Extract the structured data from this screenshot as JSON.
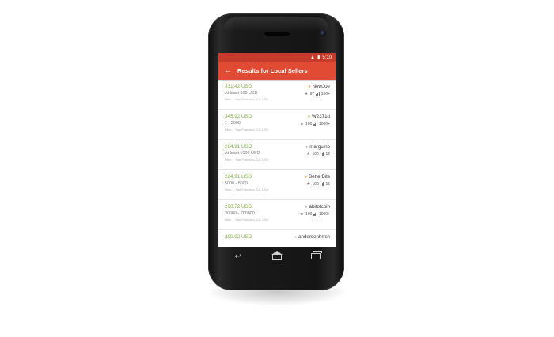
{
  "status_bar": {
    "time": "5:10",
    "signal_icon": "signal-icon",
    "battery_icon": "battery-icon"
  },
  "app_bar": {
    "title": "Results for Local Sellers",
    "back_icon": "arrow-back-icon"
  },
  "results": [
    {
      "price": "331.42 USD",
      "amount": "At least 500 USD",
      "location": "Elkin ... San Francisco, CA, USA",
      "seller": "NewJoe",
      "online_color": "#f1a33a",
      "rating": "97",
      "trades": "100+"
    },
    {
      "price": "345.92 USD",
      "amount": "1 - 2000",
      "location": "Elkin ... San Francisco, CA, USA",
      "seller": "W2371d",
      "online_color": "#7fae3f",
      "rating": "100",
      "trades": "1000+"
    },
    {
      "price": "284.91 USD",
      "amount": "At least 5000 USD",
      "location": "Elkin ... San Francisco, CA, USA",
      "seller": "marguinb",
      "online_color": "#bbbbbb",
      "rating": "100",
      "trades": "12"
    },
    {
      "price": "284.91 USD",
      "amount": "5000 - 8000",
      "location": "Elkin ... San Francisco, CA, USA",
      "seller": "BetterBits",
      "online_color": "#f1a33a",
      "rating": "100",
      "trades": "15"
    },
    {
      "price": "290.72 USD",
      "amount": "30000 - 200000",
      "location": "Elkin ... San Francisco, CA, USA",
      "seller": "abitofcoin",
      "online_color": "#bbbbbb",
      "rating": "100",
      "trades": "1000+"
    },
    {
      "price": "290.92 USD",
      "amount": "",
      "location": "",
      "seller": "andersonhrrsn",
      "online_color": "#bbbbbb",
      "rating": "",
      "trades": ""
    }
  ],
  "nav_bar": {
    "back_icon": "nav-back-icon",
    "home_icon": "nav-home-icon",
    "recents_icon": "nav-recents-icon"
  },
  "colors": {
    "accent": "#e14b34",
    "status": "#c63b2a",
    "price": "#7fae3f"
  }
}
